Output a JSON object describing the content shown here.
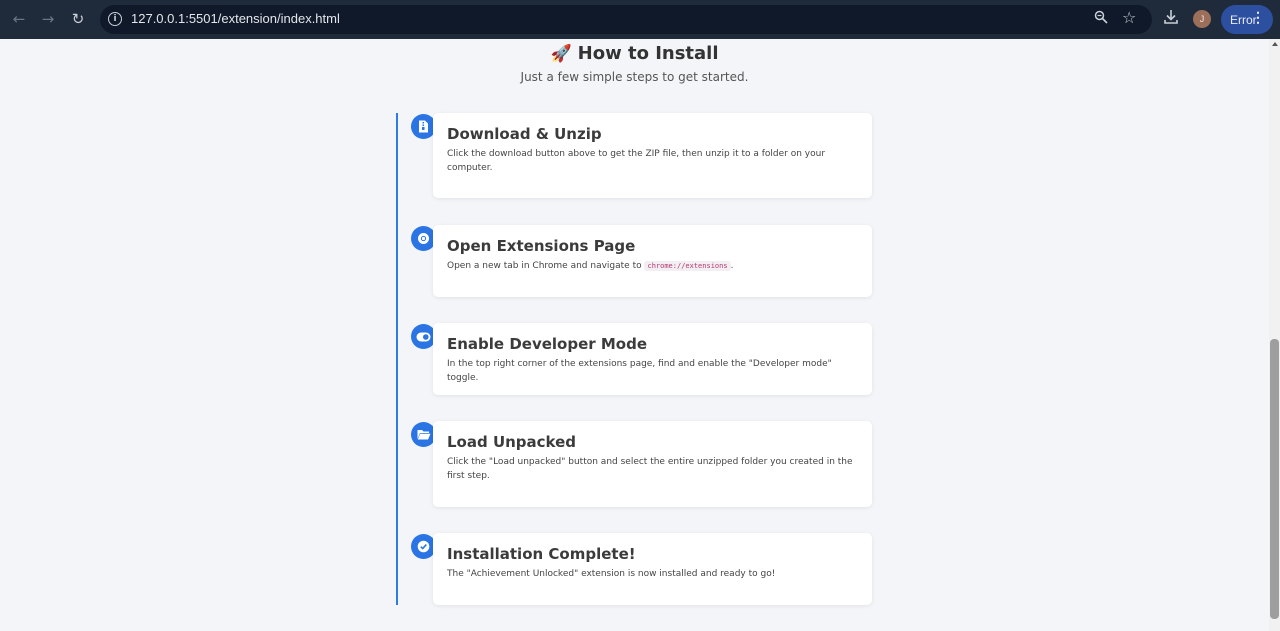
{
  "browser": {
    "url": "127.0.0.1:5501/extension/index.html",
    "avatar_letter": "J",
    "error_label": "Error"
  },
  "page": {
    "emoji": "🚀",
    "title": "How to Install",
    "subtitle": "Just a few simple steps to get started."
  },
  "steps": [
    {
      "icon": "file-zip-icon",
      "title": "Download & Unzip",
      "desc": "Click the download button above to get the ZIP file, then unzip it to a folder on your computer."
    },
    {
      "icon": "chrome-icon",
      "title": "Open Extensions Page",
      "desc_before": "Open a new tab in Chrome and navigate to ",
      "code": "chrome://extensions",
      "desc_after": "."
    },
    {
      "icon": "toggle-icon",
      "title": "Enable Developer Mode",
      "desc": "In the top right corner of the extensions page, find and enable the \"Developer mode\" toggle."
    },
    {
      "icon": "folder-open-icon",
      "title": "Load Unpacked",
      "desc": "Click the \"Load unpacked\" button and select the entire unzipped folder you created in the first step."
    },
    {
      "icon": "check-circle-icon",
      "title": "Installation Complete!",
      "desc": "The \"Achievement Unlocked\" extension is now installed and ready to go!"
    }
  ],
  "colors": {
    "accent": "#2a74e3",
    "chrome_bg": "#1f2a3a",
    "page_bg": "#f4f5f8"
  }
}
